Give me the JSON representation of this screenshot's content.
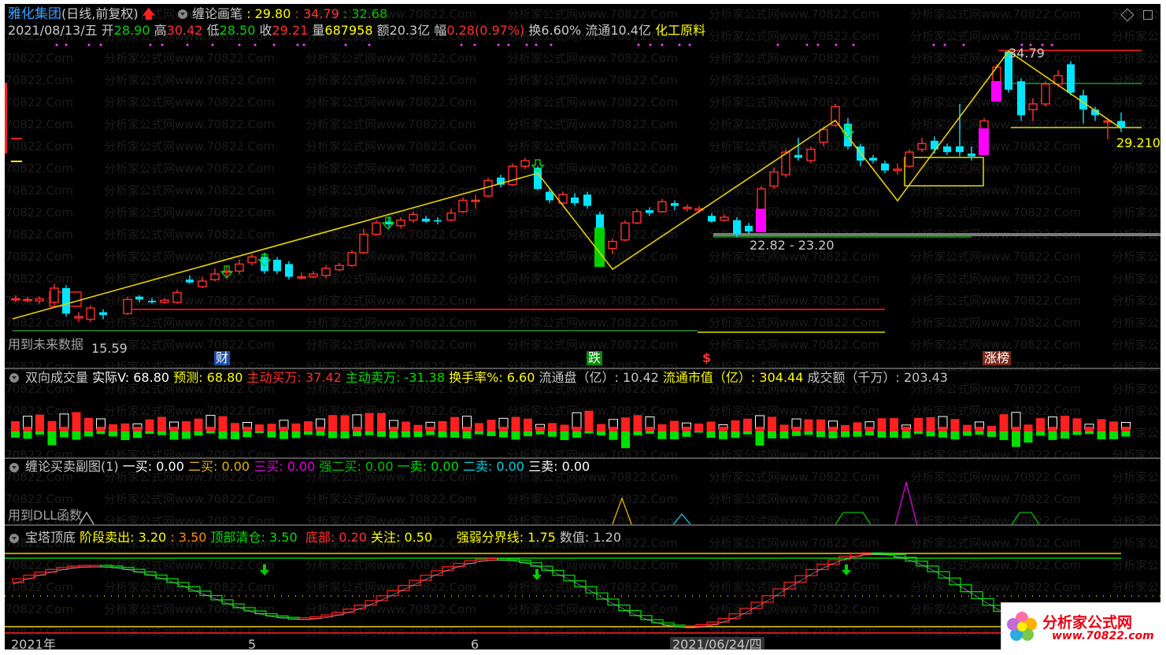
{
  "header": {
    "stock_name": "雅化集团",
    "period_label": "(日线,前复权)",
    "indicator": "缠论画笔",
    "ind_v1": ": 29.80",
    "ind_v2": ": 34.79",
    "ind_v3": ": 32.68"
  },
  "quote": {
    "date": "2021/08/13/五",
    "open_label": "开",
    "open": "28.90",
    "high_label": "高",
    "high": "30.42",
    "low_label": "低",
    "low": "28.50",
    "close_label": "收",
    "close": "29.21",
    "vol_label": "量",
    "vol": "687958",
    "amt_label": "额",
    "amt": "20.3亿",
    "chg_label": "幅",
    "chg": "0.28(0.97%)",
    "turn_label": "换",
    "turn": "6.60%",
    "float_label": "流通",
    "float": "10.4亿",
    "sector": "化工原料"
  },
  "main_chart": {
    "high_marker": "34.79",
    "last_price": "29.210",
    "range_label": "22.82 - 23.20",
    "low_marker": "15.59",
    "note": "用到未来数据",
    "badges": {
      "cai": "财",
      "die": "跌",
      "s": "$",
      "zhangbang": "涨榜"
    }
  },
  "volume_panel": {
    "title": "双向成交量",
    "actual_label": "实际V",
    "actual": ": 68.80",
    "forecast_label": "预测",
    "forecast": ": 68.80",
    "buy_label": "主动买万",
    "buy": ": 37.42",
    "sell_label": "主动卖万",
    "sell": ": -31.38",
    "turn_label": "换手率%",
    "turn": ": 6.60",
    "float_label": "流通盘（亿）",
    "float": ": 10.42",
    "cap_label": "流通市值（亿）",
    "cap": ": 304.44",
    "amt_label": "成交额（千万）",
    "amt": ": 203.43"
  },
  "signal_panel": {
    "title": "缠论买卖副图(1)",
    "b1_label": "一买",
    "b1": ": 0.00",
    "b2_label": "二买",
    "b2": ": 0.00",
    "b3_label": "三买",
    "b3": ": 0.00",
    "sb2_label": "强二买",
    "sb2": ": 0.00",
    "s1_label": "一卖",
    "s1": ": 0.00",
    "s2_label": "二卖",
    "s2": ": 0.00",
    "s3_label": "三卖",
    "s3": ": 0.00",
    "note": "用到DLL函数"
  },
  "tower_panel": {
    "title": "宝塔顶底",
    "stage_label": "阶段卖出",
    "stage1": ": 3.20",
    "stage2": ": 3.50",
    "top_label": "顶部清仓",
    "top": ": 3.50",
    "bottom_label": "底部",
    "bottom": ": 0.20",
    "watch_label": "关注",
    "watch": ": 0.50",
    "div_label": "强弱分界线",
    "div": ": 1.75",
    "value_label": "数值",
    "value": ": 1.20"
  },
  "time_axis": {
    "t1": "2021年",
    "t2": "5",
    "t3": "6",
    "t4": "2021/06/24/四"
  },
  "logo": {
    "name": "分析家公式网",
    "url": "www.70822.com"
  },
  "watermark": "分析家公式网www.70822.Com",
  "colors": {
    "up": "#ff2020",
    "down": "#00e5ff",
    "yellow": "#ffff00",
    "green": "#00ff00",
    "magenta": "#ff00ff"
  }
}
